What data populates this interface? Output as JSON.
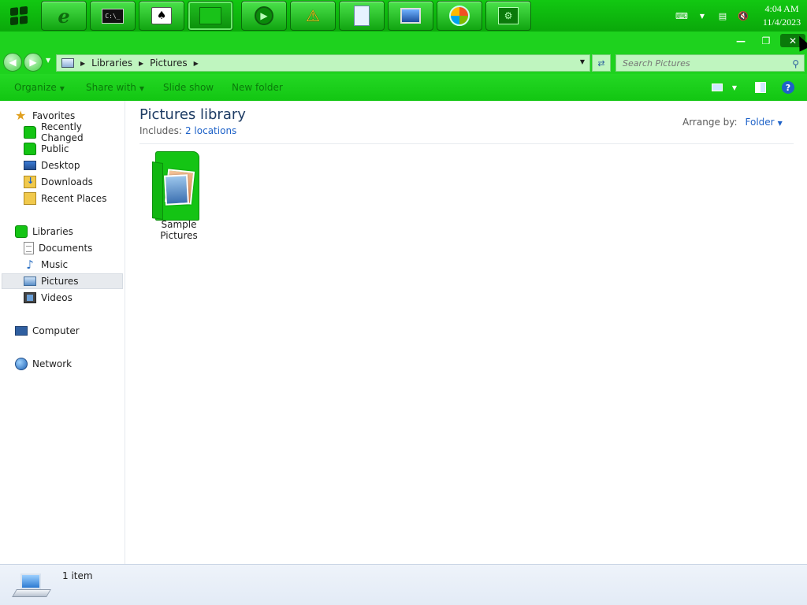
{
  "taskbar": {
    "buttons": [
      {
        "name": "internet-explorer",
        "glyph": "e"
      },
      {
        "name": "command-prompt",
        "glyph": "C:\\_"
      },
      {
        "name": "solitaire",
        "glyph": "♠"
      },
      {
        "name": "file-explorer",
        "glyph": "▦"
      },
      {
        "name": "media-player",
        "glyph": "▶"
      },
      {
        "name": "action-center",
        "glyph": "⚠"
      },
      {
        "name": "notepad",
        "glyph": "≣"
      },
      {
        "name": "remote-desktop",
        "glyph": "▣"
      },
      {
        "name": "windows-update",
        "glyph": "◉"
      },
      {
        "name": "control-panel",
        "glyph": "⚙"
      }
    ],
    "clock": {
      "time": "4:04 AM",
      "date": "11/4/2023"
    }
  },
  "window": {
    "caption": {
      "minimize": "—",
      "maximize": "❐",
      "close": "✕"
    },
    "address": {
      "breadcrumbs": [
        "Libraries",
        "Pictures"
      ],
      "search_placeholder": "Search Pictures"
    },
    "commands": {
      "organize": "Organize",
      "share_with": "Share with",
      "slide_show": "Slide show",
      "new_folder": "New folder"
    },
    "navpane": {
      "favorites": {
        "label": "Favorites",
        "items": [
          "Recently Changed",
          "Public",
          "Desktop",
          "Downloads",
          "Recent Places"
        ]
      },
      "libraries": {
        "label": "Libraries",
        "items": [
          "Documents",
          "Music",
          "Pictures",
          "Videos"
        ]
      },
      "computer": "Computer",
      "network": "Network"
    },
    "content": {
      "title": "Pictures library",
      "includes_label": "Includes:",
      "includes_link": "2 locations",
      "arrange_label": "Arrange by:",
      "arrange_value": "Folder",
      "items": [
        {
          "label": "Sample Pictures"
        }
      ]
    },
    "details": {
      "count": "1 item"
    }
  },
  "colors": {
    "chrome_green": "#1ed21e",
    "taskbar_green": "#12c812",
    "link_blue": "#1e62c8"
  }
}
